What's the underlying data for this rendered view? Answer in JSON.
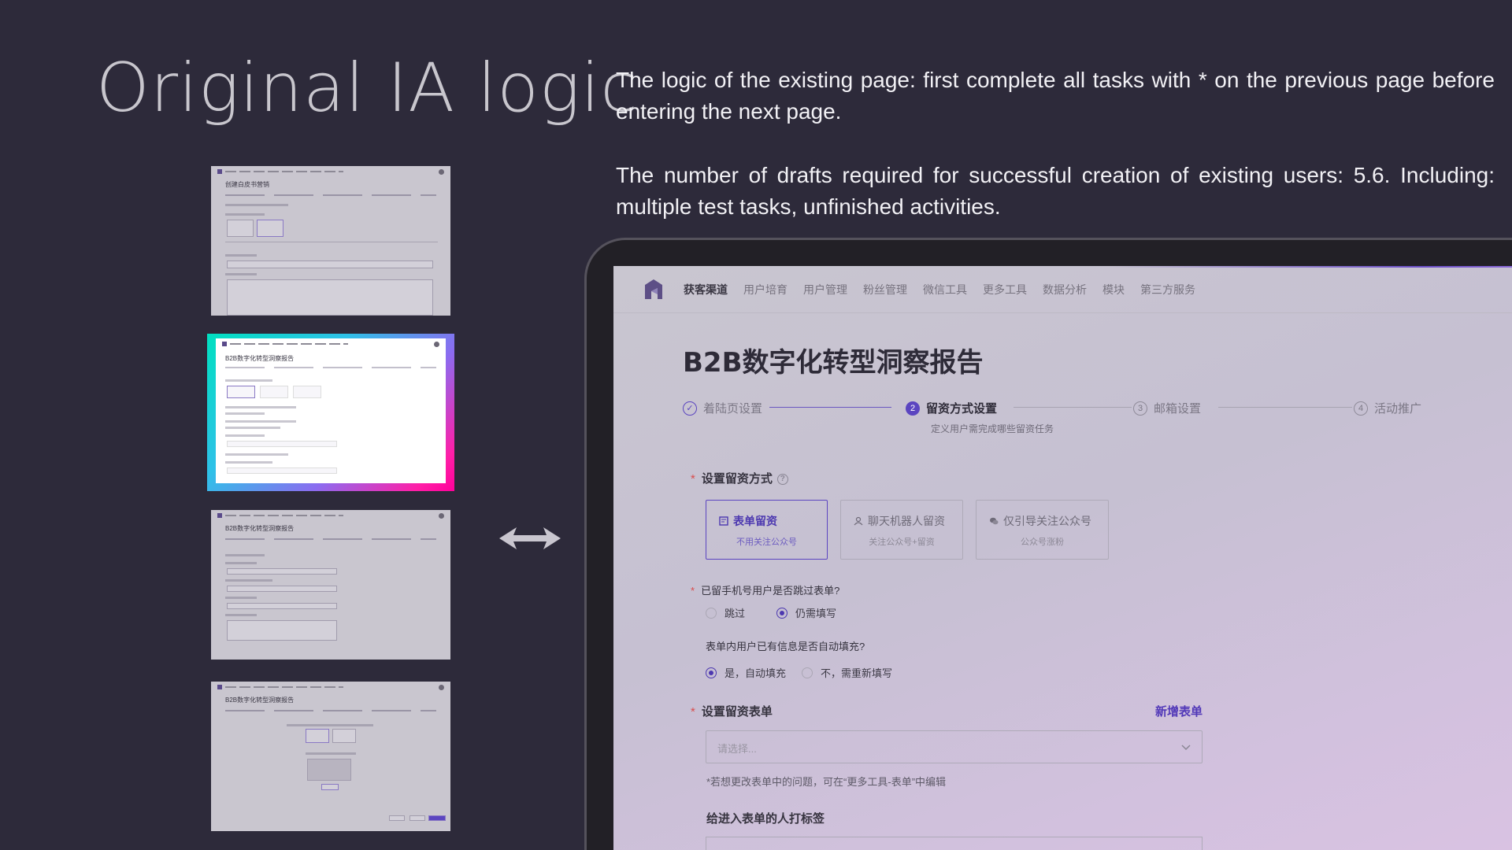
{
  "headline": "Original IA logic",
  "paragraphs": {
    "p1": "The logic of the existing page: first complete all tasks with * on the previous page before entering the next page.",
    "p2": "The number of drafts required for successful creation of existing users: 5.6. Including: multiple test tasks, unfinished activities."
  },
  "thumbnails": {
    "t1_title": "创建白皮书营销",
    "t2_title": "B2B数字化转型洞察报告",
    "t3_title": "B2B数字化转型洞察报告",
    "t4_title": "B2B数字化转型洞察报告"
  },
  "app": {
    "nav": [
      "获客渠道",
      "用户培育",
      "用户管理",
      "粉丝管理",
      "微信工具",
      "更多工具",
      "数据分析",
      "模块",
      "第三方服务"
    ],
    "title": "B2B数字化转型洞察报告",
    "steps": [
      {
        "num": "✓",
        "label": "着陆页设置",
        "state": "done"
      },
      {
        "num": "2",
        "label": "留资方式设置",
        "state": "active"
      },
      {
        "num": "3",
        "label": "邮箱设置",
        "state": "todo"
      },
      {
        "num": "4",
        "label": "活动推广",
        "state": "todo"
      }
    ],
    "step_sub": "定义用户需完成哪些留资任务",
    "section1": {
      "label": "设置留资方式",
      "required": "*",
      "help": "?",
      "options": [
        {
          "title": "表单留资",
          "sub": "不用关注公众号",
          "active": true,
          "icon": "form-icon"
        },
        {
          "title": "聊天机器人留资",
          "sub": "关注公众号+留资",
          "active": false,
          "icon": "robot-user-icon"
        },
        {
          "title": "仅引导关注公众号",
          "sub": "公众号涨粉",
          "active": false,
          "icon": "wechat-icon"
        }
      ]
    },
    "q1": {
      "required": "*",
      "label": "已留手机号用户是否跳过表单?",
      "options": [
        "跳过",
        "仍需填写"
      ],
      "selected": "仍需填写"
    },
    "q2": {
      "label": "表单内用户已有信息是否自动填充?",
      "options": [
        "是，自动填充",
        "不，需重新填写"
      ],
      "selected": "是，自动填充"
    },
    "section2": {
      "required": "*",
      "label": "设置留资表单",
      "link": "新增表单",
      "placeholder": "请选择...",
      "hint": "*若想更改表单中的问题，可在“更多工具-表单”中编辑"
    },
    "section3": {
      "label": "给进入表单的人打标签"
    }
  },
  "colors": {
    "background": "#2d2a3a",
    "accent": "#5b45c0",
    "highlight_gradient": [
      "#00e0c0",
      "#8b6cf0",
      "#ff009a"
    ]
  }
}
